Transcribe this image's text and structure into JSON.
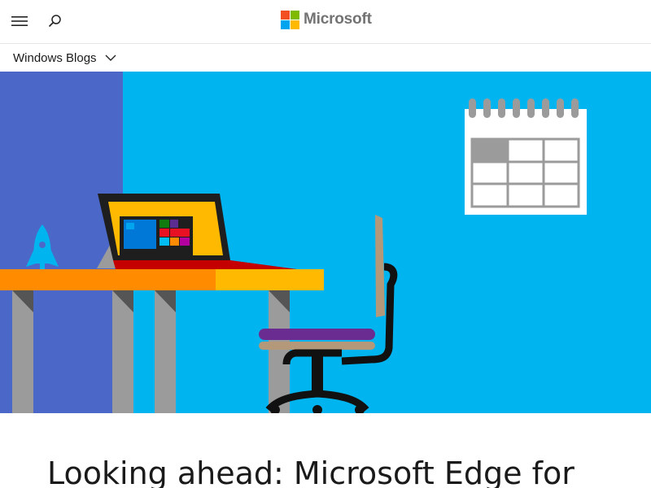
{
  "header": {
    "brand_name": "Microsoft",
    "logo_colors": [
      "#f25022",
      "#7fba00",
      "#00a4ef",
      "#ffb900"
    ],
    "menu_icon": "hamburger-menu-icon",
    "search_icon": "search-icon"
  },
  "subnav": {
    "label": "Windows Blogs",
    "dropdown_icon": "chevron-down-icon"
  },
  "hero": {
    "colors": {
      "sky": "#00b4ef",
      "wall_left": "#4b67c8",
      "desk_orange": "#ff8c00",
      "desk_yellow": "#ffb900",
      "laptop_screen": "#ffb900",
      "chair_seat": "#6b2c91",
      "rocket": "#00b4ef"
    },
    "start_tile_colors": [
      "#0078d7",
      "#00a4ef",
      "#107c10",
      "#e81123",
      "#ff8c00",
      "#5c2d91",
      "#b4009e",
      "#00bcf2"
    ]
  },
  "article": {
    "title": "Looking ahead: Microsoft Edge for"
  }
}
